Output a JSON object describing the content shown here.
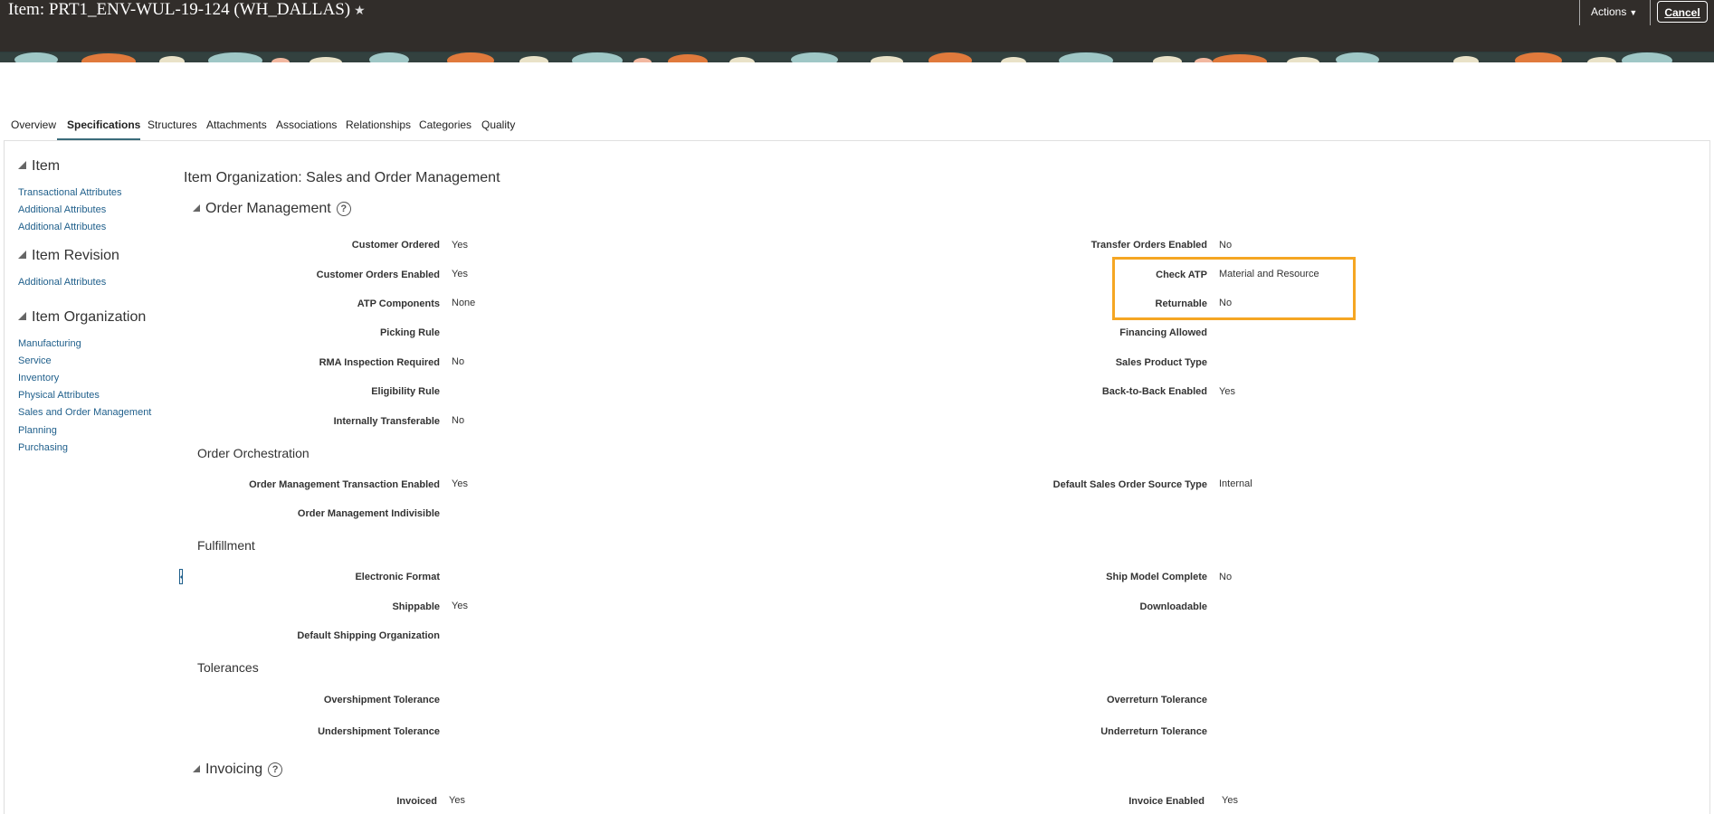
{
  "header": {
    "title": "Item: PRT1_ENV-WUL-19-124 (WH_DALLAS)",
    "actions_label": "Actions",
    "cancel_label": "Cancel"
  },
  "tabs": [
    "Overview",
    "Specifications",
    "Structures",
    "Attachments",
    "Associations",
    "Relationships",
    "Categories",
    "Quality"
  ],
  "active_tab": "Specifications",
  "nav": {
    "item": {
      "heading": "Item",
      "links": [
        "Transactional Attributes",
        "Additional Attributes",
        "Additional Attributes"
      ]
    },
    "item_revision": {
      "heading": "Item Revision",
      "links": [
        "Additional Attributes"
      ]
    },
    "item_organization": {
      "heading": "Item Organization",
      "links": [
        "Manufacturing",
        "Service",
        "Inventory",
        "Physical Attributes",
        "Sales and Order Management",
        "Planning",
        "Purchasing"
      ]
    }
  },
  "page_title": "Item Organization: Sales and Order Management",
  "order_management": {
    "heading": "Order Management",
    "left": [
      {
        "label": "Customer Ordered",
        "value": "Yes"
      },
      {
        "label": "Customer Orders Enabled",
        "value": "Yes"
      },
      {
        "label": "ATP Components",
        "value": "None"
      },
      {
        "label": "Picking Rule",
        "value": ""
      },
      {
        "label": "RMA Inspection Required",
        "value": "No"
      },
      {
        "label": "Eligibility Rule",
        "value": ""
      },
      {
        "label": "Internally Transferable",
        "value": "No"
      }
    ],
    "right": [
      {
        "label": "Transfer Orders Enabled",
        "value": "No"
      },
      {
        "label": "Check ATP",
        "value": "Material and Resource"
      },
      {
        "label": "Returnable",
        "value": "No"
      },
      {
        "label": "Financing Allowed",
        "value": ""
      },
      {
        "label": "Sales Product Type",
        "value": ""
      },
      {
        "label": "Back-to-Back Enabled",
        "value": "Yes"
      }
    ]
  },
  "order_orchestration": {
    "heading": "Order Orchestration",
    "left": [
      {
        "label": "Order Management Transaction Enabled",
        "value": "Yes"
      },
      {
        "label": "Order Management Indivisible",
        "value": ""
      }
    ],
    "right": [
      {
        "label": "Default Sales Order Source Type",
        "value": "Internal"
      }
    ]
  },
  "fulfillment": {
    "heading": "Fulfillment",
    "left": [
      {
        "label": "Electronic Format",
        "value": ""
      },
      {
        "label": "Shippable",
        "value": "Yes"
      },
      {
        "label": "Default Shipping Organization",
        "value": ""
      }
    ],
    "right": [
      {
        "label": "Ship Model Complete",
        "value": "No"
      },
      {
        "label": "Downloadable",
        "value": ""
      }
    ]
  },
  "tolerances": {
    "heading": "Tolerances",
    "left": [
      {
        "label": "Overshipment Tolerance",
        "value": ""
      },
      {
        "label": "Undershipment Tolerance",
        "value": ""
      }
    ],
    "right": [
      {
        "label": "Overreturn Tolerance",
        "value": ""
      },
      {
        "label": "Underreturn Tolerance",
        "value": ""
      }
    ]
  },
  "invoicing": {
    "heading": "Invoicing",
    "left": [
      {
        "label": "Invoiced",
        "value": "Yes"
      }
    ],
    "right": [
      {
        "label": "Invoice Enabled",
        "value": "Yes"
      }
    ]
  },
  "colors": {
    "header_bg": "#312d2a",
    "link": "#1f5f8b",
    "highlight": "#f5a623",
    "tab_underline": "#3a6b7a"
  }
}
